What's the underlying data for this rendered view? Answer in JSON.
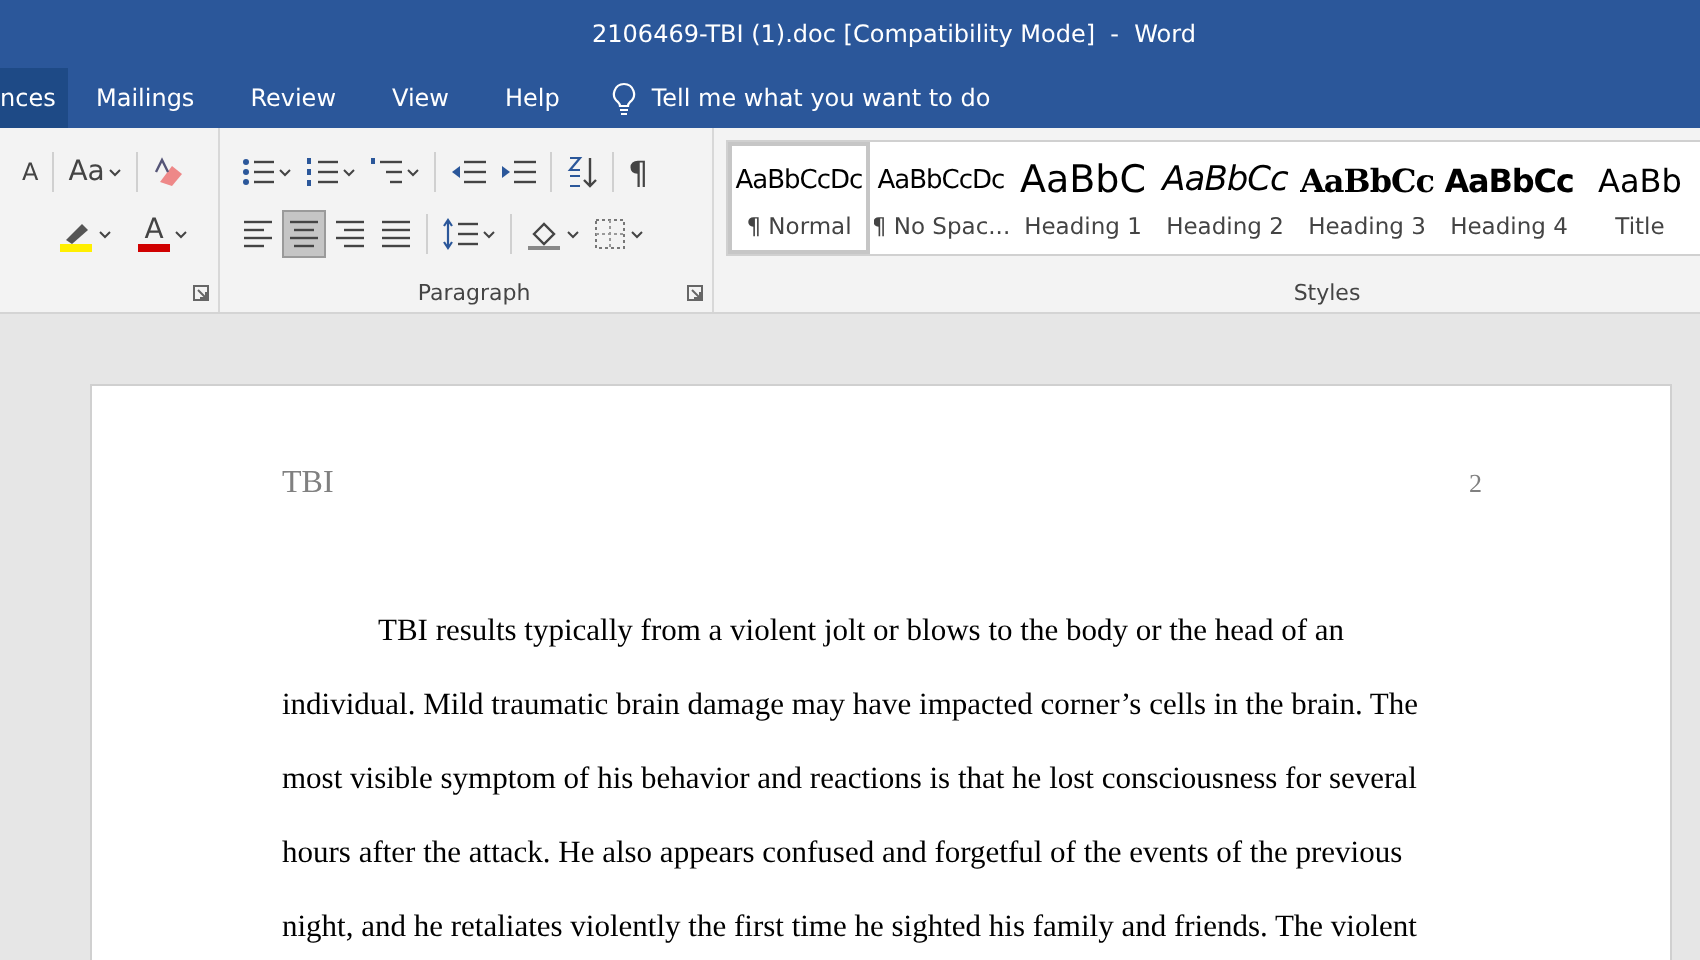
{
  "window": {
    "title": "2106469-TBI (1).doc [Compatibility Mode]  -  Word"
  },
  "tabs": [
    {
      "label": "nces",
      "selected": true
    },
    {
      "label": "Mailings",
      "selected": false
    },
    {
      "label": "Review",
      "selected": false
    },
    {
      "label": "View",
      "selected": false
    },
    {
      "label": "Help",
      "selected": false
    }
  ],
  "tell_me": {
    "placeholder": "Tell me what you want to do"
  },
  "font_group": {
    "grow_font": "A",
    "change_case": "Aa",
    "font_color": "A"
  },
  "paragraph_group": {
    "label": "Paragraph",
    "show_marks": "¶",
    "alignments": [
      {
        "kind": "left",
        "selected": false
      },
      {
        "kind": "center",
        "selected": true
      },
      {
        "kind": "right",
        "selected": false
      },
      {
        "kind": "justify",
        "selected": false
      }
    ]
  },
  "styles_group": {
    "label": "Styles",
    "items": [
      {
        "preview": "AaBbCcDc",
        "name": "¶ Normal",
        "kind": "body",
        "selected": true
      },
      {
        "preview": "AaBbCcDc",
        "name": "¶ No Spac...",
        "kind": "body",
        "selected": false
      },
      {
        "preview": "AaBbC",
        "name": "Heading 1",
        "kind": "large",
        "selected": false
      },
      {
        "preview": "AaBbCc",
        "name": "Heading 2",
        "kind": "italic",
        "selected": false
      },
      {
        "preview": "AaBbCc",
        "name": "Heading 3",
        "kind": "serif-bold",
        "selected": false
      },
      {
        "preview": "AaBbCc",
        "name": "Heading 4",
        "kind": "bold",
        "selected": false
      },
      {
        "preview": "AaBb",
        "name": "Title",
        "kind": "title",
        "selected": false
      }
    ]
  },
  "document": {
    "header_left": "TBI",
    "page_number": "2",
    "lines": [
      "TBI results typically from a violent jolt or blows to the body or the head of an",
      "individual. Mild traumatic brain damage may have impacted corner’s cells in the brain. The",
      "most visible symptom of his behavior and reactions is that he lost consciousness for several",
      "hours after the attack. He also appears confused and forgetful of the events of the previous",
      "night, and he retaliates violently the first time he sighted his family and friends. The violent"
    ]
  }
}
